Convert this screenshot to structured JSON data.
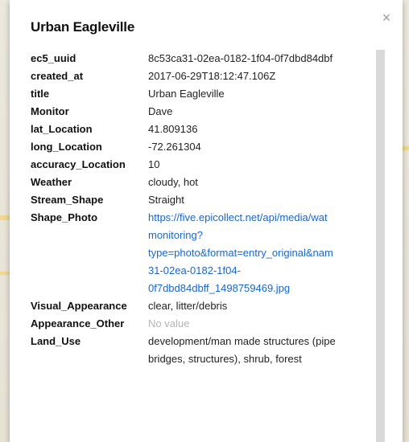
{
  "popup": {
    "title": "Urban Eagleville",
    "close_label": "×",
    "fields": [
      {
        "key": "ec5_uuid",
        "value": "8c53ca31-02ea-0182-1f04-0f7dbd84dbf"
      },
      {
        "key": "created_at",
        "value": "2017-06-29T18:12:47.106Z"
      },
      {
        "key": "title",
        "value": "Urban Eagleville"
      },
      {
        "key": "Monitor",
        "value": "Dave"
      },
      {
        "key": "lat_Location",
        "value": "41.809136"
      },
      {
        "key": "long_Location",
        "value": "-72.261304"
      },
      {
        "key": "accuracy_Location",
        "value": "10"
      },
      {
        "key": "Weather",
        "value": "cloudy, hot"
      },
      {
        "key": "Stream_Shape",
        "value": "Straight"
      },
      {
        "key": "Shape_Photo",
        "lines": [
          "https://five.epicollect.net/api/media/wat",
          "monitoring?",
          "type=photo&format=entry_original&nam",
          "31-02ea-0182-1f04-",
          "0f7dbd84dbff_1498759469.jpg"
        ]
      },
      {
        "key": "Visual_Appearance",
        "value": "clear, litter/debris"
      },
      {
        "key": "Appearance_Other",
        "value": "No value"
      },
      {
        "key": "Land_Use",
        "lines": [
          "development/man made structures (pipe",
          "bridges, structures), shrub, forest"
        ]
      }
    ]
  }
}
